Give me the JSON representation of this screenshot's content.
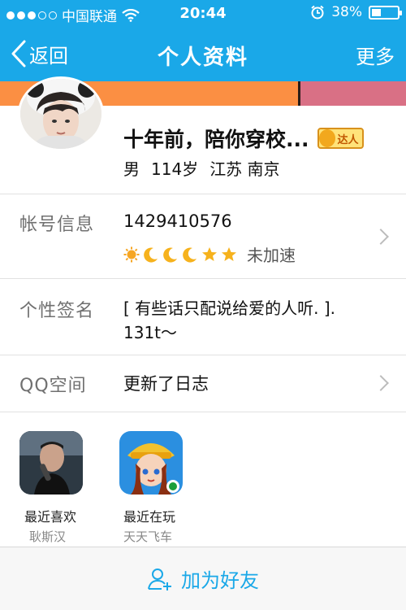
{
  "status_bar": {
    "carrier": "中国联通",
    "time": "20:44",
    "battery": "38%",
    "battery_level": 0.38
  },
  "nav": {
    "back_label": "返回",
    "title": "个人资料",
    "more_label": "更多"
  },
  "profile": {
    "name": "十年前，陪你穿校...",
    "badge": "达人",
    "gender": "男",
    "age": "114岁",
    "location": "江苏 南京"
  },
  "account": {
    "label": "帐号信息",
    "qq_number": "1429410576",
    "level_icons": [
      "sun-icon",
      "moon-icon",
      "moon-icon",
      "moon-icon",
      "star-icon",
      "star-icon"
    ],
    "speed_status": "未加速"
  },
  "signature": {
    "label": "个性签名",
    "text": "[ 有些话只配说给爱的人听. ]. 131t～"
  },
  "qzone": {
    "label": "QQ空间",
    "value": "更新了日志"
  },
  "recent": [
    {
      "label": "最近喜欢",
      "sub": "耿斯汉"
    },
    {
      "label": "最近在玩",
      "sub": "天天飞车"
    }
  ],
  "bottom": {
    "add_friend_label": "加为好友"
  },
  "colors": {
    "accent": "#1aa8e8",
    "cover_orange": "#fb8f43",
    "cover_pink": "#d97085",
    "badge_gold": "#ffe37a"
  }
}
